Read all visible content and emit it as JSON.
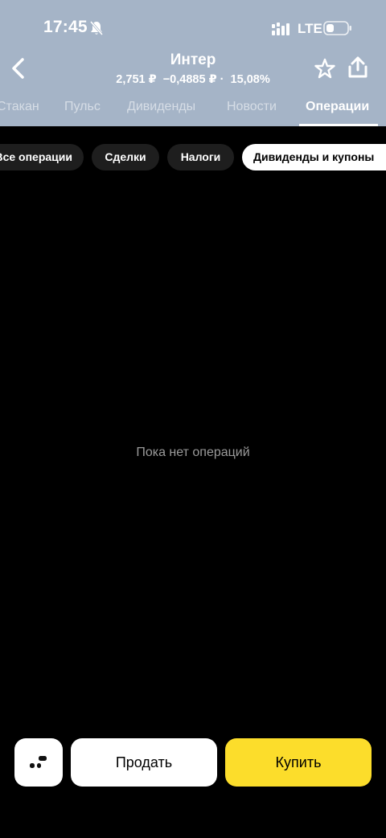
{
  "status_bar": {
    "time": "17:45",
    "network": "LTE",
    "icons": [
      "bell-muted-icon",
      "signal-icon",
      "battery-icon"
    ]
  },
  "header": {
    "title": "Интер",
    "price": "2,751 ₽",
    "change": "−0,4885 ₽",
    "separator": "·",
    "change_percent": "15,08%",
    "icons": [
      "chevron-left-icon",
      "star-icon",
      "share-icon"
    ]
  },
  "tabs": [
    {
      "label": "Стакан",
      "active": false
    },
    {
      "label": "Пульс",
      "active": false
    },
    {
      "label": "Дивиденды",
      "active": false
    },
    {
      "label": "Новости",
      "active": false
    },
    {
      "label": "Операции",
      "active": true
    }
  ],
  "filters": [
    {
      "label": "Все операции",
      "active": false
    },
    {
      "label": "Сделки",
      "active": false
    },
    {
      "label": "Налоги",
      "active": false
    },
    {
      "label": "Дивиденды и купоны",
      "active": true
    }
  ],
  "empty_state": {
    "text": "Пока нет операций"
  },
  "actions": {
    "menu_icon": "menu-icon",
    "sell_label": "Продать",
    "buy_label": "Купить"
  },
  "colors": {
    "header_bg": "#a5b4c7",
    "buy_button": "#fcdd2b",
    "chip_bg": "#1e1e1e",
    "empty_text": "#9a9a9a"
  }
}
